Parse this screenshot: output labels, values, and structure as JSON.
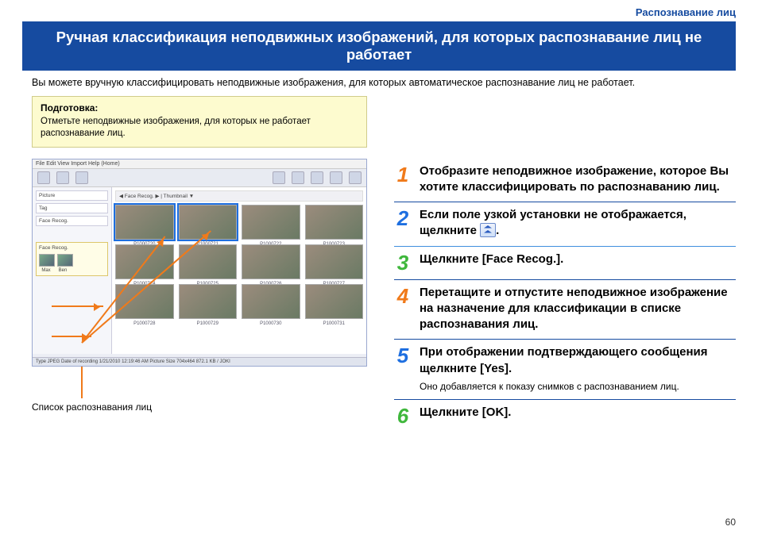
{
  "header": {
    "section": "Распознавание лиц"
  },
  "title": "Ручная классификация неподвижных изображений, для которых распознавание лиц не работает",
  "intro": "Вы можете вручную классифицировать неподвижные изображения, для которых автоматическое распознавание лиц не работает.",
  "prep": {
    "heading": "Подготовка:",
    "text": "Отметьте неподвижные изображения, для которых не работает распознавание лиц."
  },
  "caption": "Список распознавания лиц",
  "app": {
    "menus": "File  Edit  View  Import  Help  (Home)",
    "sidebar": [
      "Picture",
      "Tag",
      "Face Recog."
    ],
    "face_panel_label": "Face Recog.",
    "people": [
      "Max",
      "Ben"
    ],
    "crumb": "◀  Face Recog. ▶  | Thumbnail ▼",
    "thumbs": [
      "P1000720",
      "P1000721",
      "P1000722",
      "P1000723",
      "P1000724",
      "P1000725",
      "P1000726",
      "P1000727",
      "P1000728",
      "P1000729",
      "P1000730",
      "P1000731"
    ],
    "status": "Type JPEG   Date of recording 1/21/2010 12:19:46 AM   Picture Size 704x464   872.1 KB / JOKI"
  },
  "steps": [
    {
      "n": "1",
      "color": "c-orange",
      "text": "Отобразите неподвижное изображение, которое Вы хотите классифицировать по распознаванию лиц."
    },
    {
      "n": "2",
      "color": "c-blue",
      "text_pre": "Если поле узкой установки не отображается, щелкните ",
      "text_post": "."
    },
    {
      "n": "3",
      "color": "c-green",
      "text": "Щелкните [Face Recog.]."
    },
    {
      "n": "4",
      "color": "c-orange",
      "text": "Перетащите и отпустите неподвижное изображение на назначение для классификации в списке распознавания лиц."
    },
    {
      "n": "5",
      "color": "c-blue",
      "text": "При отображении подтверждающего сообщения щелкните [Yes].",
      "sub": "Оно добавляется к показу снимков с распознаванием лиц."
    },
    {
      "n": "6",
      "color": "c-green",
      "text": "Щелкните [OK]."
    }
  ],
  "page_number": "60"
}
